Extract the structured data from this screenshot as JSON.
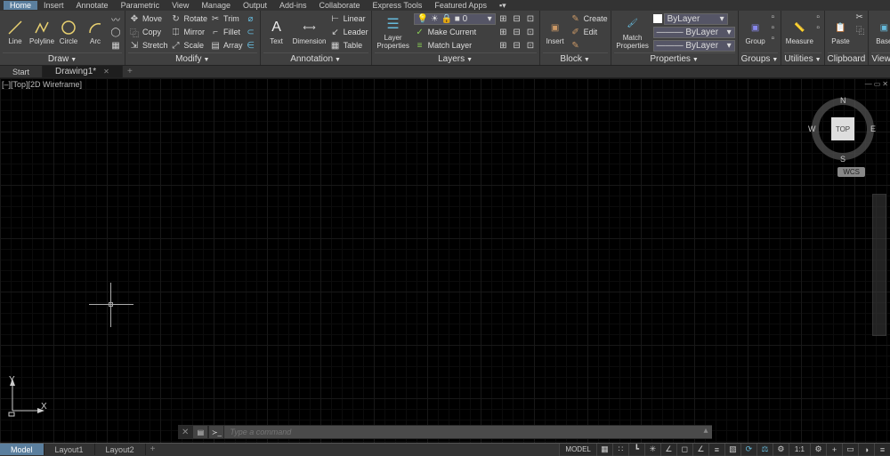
{
  "menu": {
    "tabs": [
      "Home",
      "Insert",
      "Annotate",
      "Parametric",
      "View",
      "Manage",
      "Output",
      "Add-ins",
      "Collaborate",
      "Express Tools",
      "Featured Apps"
    ],
    "active": 0
  },
  "ribbon": {
    "draw": {
      "label": "Draw",
      "items": {
        "line": "Line",
        "polyline": "Polyline",
        "circle": "Circle",
        "arc": "Arc"
      }
    },
    "modify": {
      "label": "Modify",
      "items": {
        "move": "Move",
        "rotate": "Rotate",
        "trim": "Trim",
        "copy": "Copy",
        "mirror": "Mirror",
        "fillet": "Fillet",
        "stretch": "Stretch",
        "scale": "Scale",
        "array": "Array"
      }
    },
    "annotation": {
      "label": "Annotation",
      "items": {
        "text": "Text",
        "dimension": "Dimension",
        "linear": "Linear",
        "leader": "Leader",
        "table": "Table"
      }
    },
    "layers": {
      "label": "Layers",
      "items": {
        "properties": "Layer\nProperties",
        "make_current": "Make Current",
        "match_layer": "Match Layer"
      },
      "selected": "0"
    },
    "block": {
      "label": "Block",
      "items": {
        "insert": "Insert",
        "create": "Create",
        "edit": "Edit"
      }
    },
    "properties": {
      "label": "Properties",
      "items": {
        "match": "Match\nProperties"
      },
      "color": "ByLayer",
      "line1": "ByLayer",
      "line2": "ByLayer"
    },
    "groups": {
      "label": "Groups",
      "item": "Group"
    },
    "utilities": {
      "label": "Utilities",
      "item": "Measure"
    },
    "clipboard": {
      "label": "Clipboard",
      "item": "Paste"
    },
    "view": {
      "label": "View",
      "item": "Base"
    }
  },
  "doctabs": {
    "start": "Start",
    "drawing": "Drawing1*"
  },
  "viewport": {
    "label": "[–][Top][2D Wireframe]",
    "cube_face": "TOP",
    "wcs": "WCS",
    "dirs": {
      "n": "N",
      "e": "E",
      "s": "S",
      "w": "W"
    },
    "ucs": {
      "x": "X",
      "y": "Y"
    }
  },
  "cmd": {
    "placeholder": "Type a command"
  },
  "layouts": {
    "model": "Model",
    "l1": "Layout1",
    "l2": "Layout2"
  },
  "status": {
    "model": "MODEL",
    "scale": "1:1"
  }
}
